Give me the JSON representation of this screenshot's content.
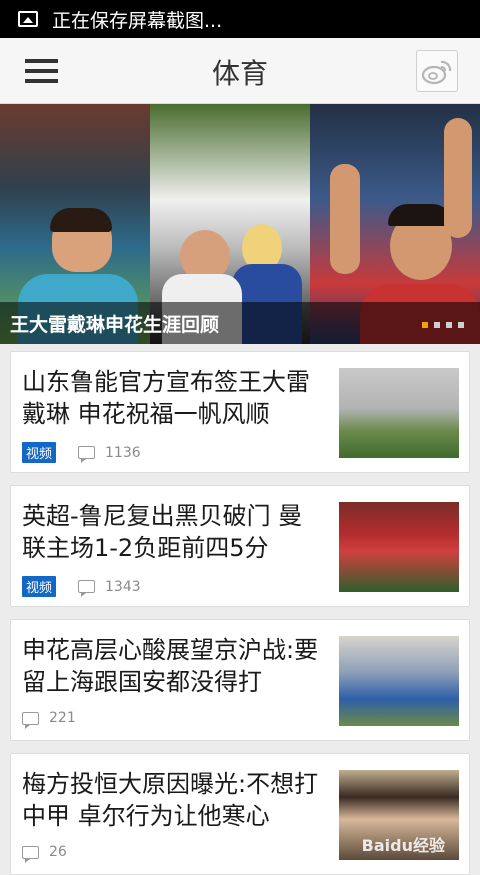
{
  "status_bar": {
    "notification_text": "正在保存屏幕截图..."
  },
  "header": {
    "title": "体育"
  },
  "hero": {
    "caption": "王大雷戴琳申花生涯回顾",
    "slide_count": 4,
    "active_slide": 1,
    "accent_color": "#f0a400"
  },
  "articles": [
    {
      "title": "山东鲁能官方宣布签王大雷戴琳 申花祝福一帆风顺",
      "badge": "视频",
      "comments": "1136"
    },
    {
      "title": "英超-鲁尼复出黑贝破门 曼联主场1-2负距前四5分",
      "badge": "视频",
      "comments": "1343"
    },
    {
      "title": "申花高层心酸展望京沪战:要留上海跟国安都没得打",
      "badge": "",
      "comments": "221"
    },
    {
      "title": "梅方投恒大原因曝光:不想打中甲 卓尔行为让他寒心",
      "badge": "",
      "comments": "26",
      "watermark": "Baidu经验"
    }
  ],
  "colors": {
    "badge": "#1368c6",
    "status_bar": "#000000"
  }
}
